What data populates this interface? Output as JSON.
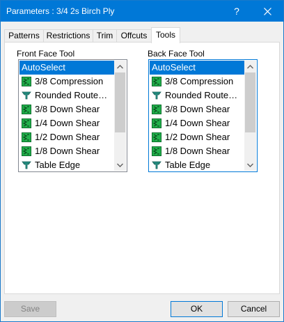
{
  "window": {
    "title": "Parameters : 3/4 2s Birch Ply",
    "help_label": "?"
  },
  "tabs": [
    {
      "label": "Patterns"
    },
    {
      "label": "Restrictions"
    },
    {
      "label": "Trim"
    },
    {
      "label": "Offcuts"
    },
    {
      "label": "Tools"
    }
  ],
  "active_tab": "Tools",
  "front": {
    "label": "Front Face Tool",
    "items": [
      {
        "label": "AutoSelect",
        "icon": "none"
      },
      {
        "label": "3/8 Compression",
        "icon": "green-bit-icon"
      },
      {
        "label": "Rounded Route…",
        "icon": "teal-router-icon"
      },
      {
        "label": "3/8 Down Shear",
        "icon": "green-bit-icon"
      },
      {
        "label": "1/4 Down Shear",
        "icon": "green-bit-icon"
      },
      {
        "label": "1/2 Down Shear",
        "icon": "green-bit-icon"
      },
      {
        "label": "1/8 Down Shear",
        "icon": "green-bit-icon"
      },
      {
        "label": "Table Edge",
        "icon": "teal-router-icon"
      }
    ],
    "selected": "AutoSelect"
  },
  "back": {
    "label": "Back Face Tool",
    "items": [
      {
        "label": "AutoSelect",
        "icon": "none"
      },
      {
        "label": "3/8 Compression",
        "icon": "green-bit-icon"
      },
      {
        "label": "Rounded Route…",
        "icon": "teal-router-icon"
      },
      {
        "label": "3/8 Down Shear",
        "icon": "green-bit-icon"
      },
      {
        "label": "1/4 Down Shear",
        "icon": "green-bit-icon"
      },
      {
        "label": "1/2 Down Shear",
        "icon": "green-bit-icon"
      },
      {
        "label": "1/8 Down Shear",
        "icon": "green-bit-icon"
      },
      {
        "label": "Table Edge",
        "icon": "teal-router-icon"
      }
    ],
    "selected": "AutoSelect"
  },
  "buttons": {
    "save": "Save",
    "ok": "OK",
    "cancel": "Cancel"
  },
  "colors": {
    "titlebar": "#0078d7",
    "selection": "#0078d7",
    "bit_icon": "#22b14c",
    "router_icon": "#2a9d8f"
  }
}
